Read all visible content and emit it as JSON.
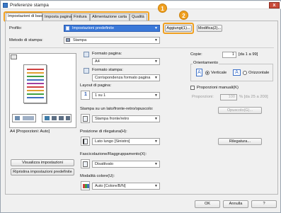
{
  "window": {
    "title": "Preferenze stampa",
    "close_glyph": "x"
  },
  "tabs": [
    {
      "label": "Impostazioni di base",
      "active": true
    },
    {
      "label": "Imposta pagina"
    },
    {
      "label": "Finitura"
    },
    {
      "label": "Alimentazione carta"
    },
    {
      "label": "Qualità"
    }
  ],
  "callouts": {
    "one": "1",
    "two": "2"
  },
  "profile": {
    "label": "Profilo:",
    "value": "Impostazioni predefinite",
    "add_button": "Aggiungi(1)...",
    "edit_button": "Modifica(2)..."
  },
  "output_method": {
    "label": "Metodo di stampa:",
    "value": "Stampa"
  },
  "page_size": {
    "label": "Formato pagina:",
    "value": "A4"
  },
  "output_size": {
    "label": "Formato stampa:",
    "value": "Corrispondenza formato pagina"
  },
  "copies": {
    "label": "Copie:",
    "value": "1",
    "range": "[da 1 a 99]"
  },
  "orientation": {
    "label": "Orientamento",
    "portrait": "Verticale",
    "landscape": "Orizzontale",
    "portrait_glyph": "A",
    "landscape_glyph": "A"
  },
  "page_layout": {
    "label": "Layout di pagina:",
    "value": "1 su 1",
    "icon_glyph": "1"
  },
  "manual_scaling": {
    "label": "Proporzioni manuali(K)",
    "sub_label": "Proporzioni:",
    "value": "100",
    "range": "% [da 25 a 200]"
  },
  "duplex": {
    "label": "Stampa su un lato/fronte-retro/opuscolo:",
    "value": "Stampa fronte/retro",
    "booklet_button": "Opuscolo(G)..."
  },
  "binding": {
    "label": "Posizione di rilegatura(H):",
    "value": "Lato lungo [Sinistro]",
    "gutter_button": "Rilegatura..."
  },
  "collate": {
    "label": "Fascicolazione/Raggruppamento(X):",
    "value": "Disattivato"
  },
  "color_mode": {
    "label": "Modalità colore(U):",
    "value": "Auto [Colore/B/N]"
  },
  "preview": {
    "caption": "A4 [Proporzioni: Auto]",
    "view_button": "Visualizza impostazioni",
    "restore_button": "Ripristina impostazioni predefinite"
  },
  "footer": {
    "ok": "OK",
    "cancel": "Annulla",
    "help": "?"
  },
  "colors": {
    "accent_callout": "#f0a020",
    "selection_blue": "#3a78d8"
  }
}
